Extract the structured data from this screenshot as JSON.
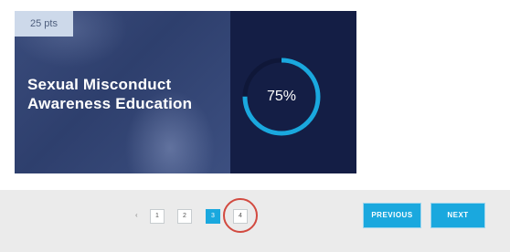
{
  "card": {
    "points": "25 pts",
    "title": "Sexual Misconduct\nAwareness Education",
    "progress": {
      "percent": 75,
      "label": "75%"
    }
  },
  "pagination": {
    "pages": [
      {
        "label": "1",
        "active": false
      },
      {
        "label": "2",
        "active": false
      },
      {
        "label": "3",
        "active": true
      },
      {
        "label": "4",
        "active": false
      }
    ],
    "highlighted_page": "4"
  },
  "buttons": {
    "previous": "PREVIOUS",
    "next": "NEXT"
  },
  "colors": {
    "accent": "#1aa8de",
    "card_navy": "#141e45",
    "badge_bg": "#cdd9ea",
    "highlight_circle": "#d24a40"
  }
}
